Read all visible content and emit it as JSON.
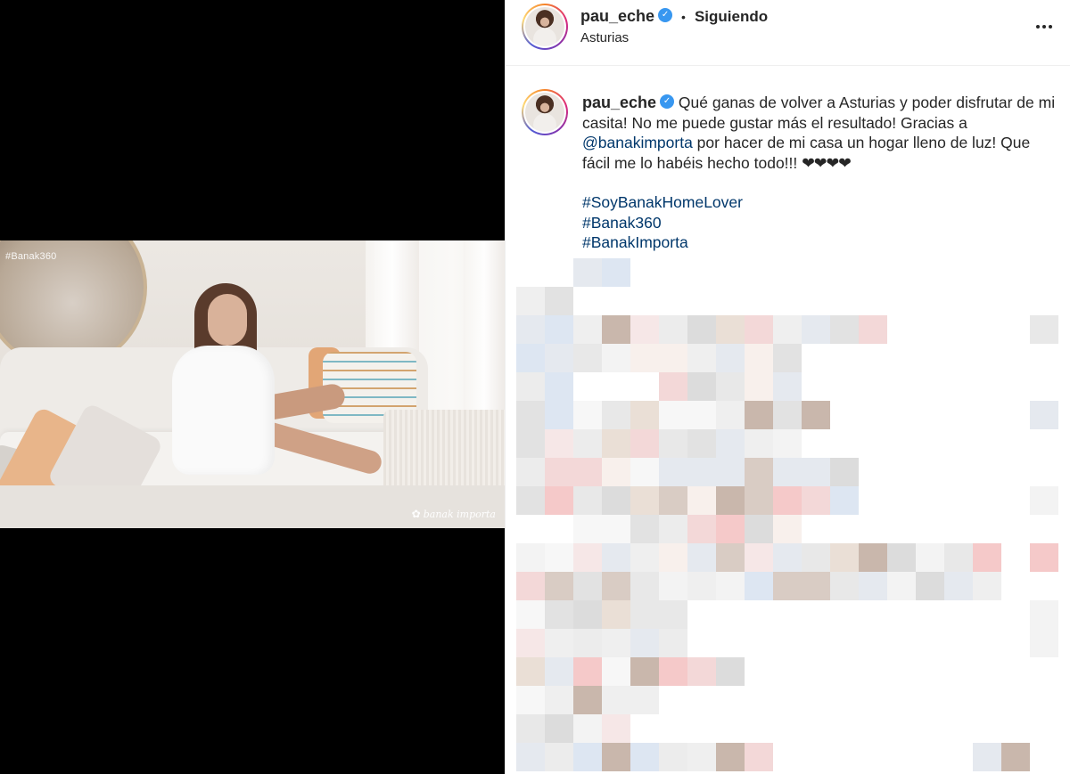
{
  "media": {
    "video_tag": "#Banak360",
    "watermark": "banak importa"
  },
  "post": {
    "author": {
      "username": "pau_eche",
      "verified_icon": "check-badge",
      "follow_status": "Siguiendo",
      "location": "Asturias"
    },
    "header_more_icon": "more-horizontal",
    "caption": {
      "username": "pau_eche",
      "text_part1": "Qué ganas de volver a Asturias y poder disfrutar de mi casita! No me puede gustar más el resultado! Gracias a ",
      "mention": "@banakimporta",
      "text_part2": " por hacer de mi casa un hogar lleno de luz! Que fácil me lo habéis hecho todo!!! ",
      "hearts": "❤❤❤❤",
      "hashtags": [
        "#SoyBanakHomeLover",
        "#Banak360",
        "#BanakImporta"
      ]
    }
  },
  "colors": {
    "link": "#00376b",
    "verified": "#3897f0",
    "text": "#262626"
  }
}
